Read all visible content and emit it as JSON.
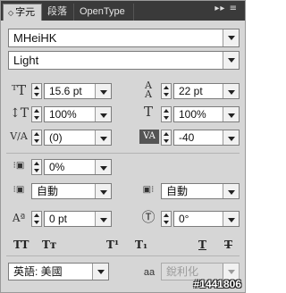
{
  "tabs": [
    {
      "label": "字元",
      "active": true
    },
    {
      "label": "段落",
      "active": false
    },
    {
      "label": "OpenType",
      "active": false
    }
  ],
  "panel_menu_glyph": "▸▸ ≡",
  "font_family": "MHeiHK",
  "font_style": "Light",
  "font_size": "15.6 pt",
  "leading": "22 pt",
  "vertical_scale": "100%",
  "horizontal_scale": "100%",
  "kerning": "(0)",
  "tracking": "-40",
  "tsume": "0%",
  "aki_left": "自動",
  "aki_right": "自動",
  "baseline_shift": "0 pt",
  "rotation": "0°",
  "style_buttons": [
    "TT",
    "Tт",
    "T¹",
    "T₁",
    "T",
    "T"
  ],
  "language": "英語: 美國",
  "antialias_label": "aa",
  "antialias": "銳利化",
  "watermark": "#1441806"
}
